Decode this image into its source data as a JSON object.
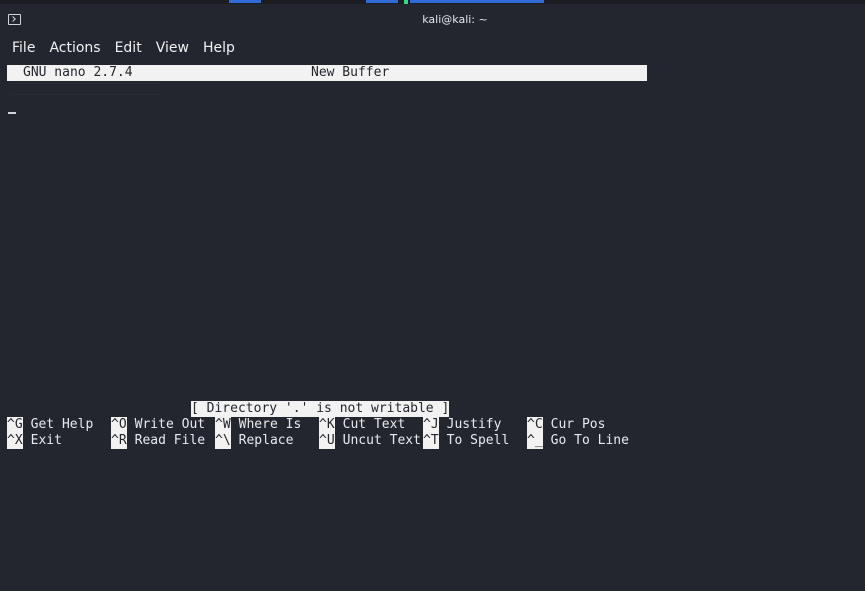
{
  "window": {
    "title": "kali@kali: ~"
  },
  "menu": {
    "items": [
      "File",
      "Actions",
      "Edit",
      "View",
      "Help"
    ]
  },
  "nano": {
    "version": "GNU nano 2.7.4",
    "buffer_name": "New Buffer",
    "status_message": "[ Directory '.' is not writable ]",
    "shortcuts_row1": [
      {
        "key": "^G",
        "label": "Get Help"
      },
      {
        "key": "^O",
        "label": "Write Out"
      },
      {
        "key": "^W",
        "label": "Where Is"
      },
      {
        "key": "^K",
        "label": "Cut Text"
      },
      {
        "key": "^J",
        "label": "Justify"
      },
      {
        "key": "^C",
        "label": "Cur Pos"
      }
    ],
    "shortcuts_row2": [
      {
        "key": "^X",
        "label": "Exit"
      },
      {
        "key": "^R",
        "label": "Read File"
      },
      {
        "key": "^\\",
        "label": "Replace"
      },
      {
        "key": "^U",
        "label": "Uncut Text"
      },
      {
        "key": "^T",
        "label": "To Spell"
      },
      {
        "key": "^_",
        "label": "Go To Line"
      }
    ]
  },
  "icons": {
    "window_icon": "terminal-icon"
  },
  "colors": {
    "background": "#23262e",
    "inverse_bar": "#f2f2f2",
    "panel_accent": "#2f6bd8",
    "panel_indicator": "#3ad87a"
  }
}
